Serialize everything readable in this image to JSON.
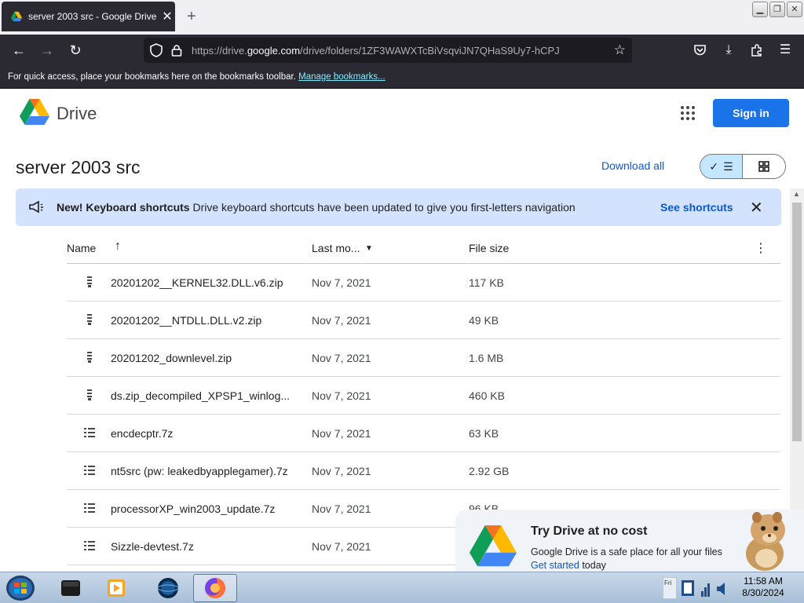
{
  "browser": {
    "tab_title": "server 2003 src - Google Drive",
    "url_prefix": "https://drive.",
    "url_domain": "google.com",
    "url_path": "/drive/folders/1ZF3WAWXTcBiVsqviJN7QHaS9Uy7-hCPJ",
    "bookmarks_text": "For quick access, place your bookmarks here on the bookmarks toolbar.",
    "manage_bookmarks": "Manage bookmarks..."
  },
  "header": {
    "app_name": "Drive",
    "signin_label": "Sign in"
  },
  "folder": {
    "title": "server 2003 src",
    "download_all": "Download all"
  },
  "banner": {
    "title": "New! Keyboard shortcuts",
    "message": "Drive keyboard shortcuts have been updated to give you first-letters navigation",
    "action": "See shortcuts"
  },
  "table": {
    "columns": {
      "name": "Name",
      "modified": "Last mo...",
      "size": "File size"
    },
    "rows": [
      {
        "name": "20201202__KERNEL32.DLL.v6.zip",
        "date": "Nov 7, 2021",
        "size": "117 KB",
        "icon": "zip-icon"
      },
      {
        "name": "20201202__NTDLL.DLL.v2.zip",
        "date": "Nov 7, 2021",
        "size": "49 KB",
        "icon": "zip-icon"
      },
      {
        "name": "20201202_downlevel.zip",
        "date": "Nov 7, 2021",
        "size": "1.6 MB",
        "icon": "zip-icon"
      },
      {
        "name": "ds.zip_decompiled_XPSP1_winlog...",
        "date": "Nov 7, 2021",
        "size": "460 KB",
        "icon": "zip-icon"
      },
      {
        "name": "encdecptr.7z",
        "date": "Nov 7, 2021",
        "size": "63 KB",
        "icon": "archive-list-icon"
      },
      {
        "name": "nt5src (pw: leakedbyapplegamer).7z",
        "date": "Nov 7, 2021",
        "size": "2.92 GB",
        "icon": "archive-list-icon"
      },
      {
        "name": "processorXP_win2003_update.7z",
        "date": "Nov 7, 2021",
        "size": "96 KB",
        "icon": "archive-list-icon"
      },
      {
        "name": "Sizzle-devtest.7z",
        "date": "Nov 7, 2021",
        "size": "",
        "icon": "archive-list-icon"
      }
    ]
  },
  "promo": {
    "title": "Try Drive at no cost",
    "desc": "Google Drive is a safe place for all your files",
    "get_started": "Get started",
    "today": " today"
  },
  "taskbar": {
    "time": "11:58 AM",
    "date": "8/30/2024"
  },
  "colors": {
    "accent": "#1a73e8",
    "banner": "#d3e3fd",
    "link": "#0b57d0"
  }
}
